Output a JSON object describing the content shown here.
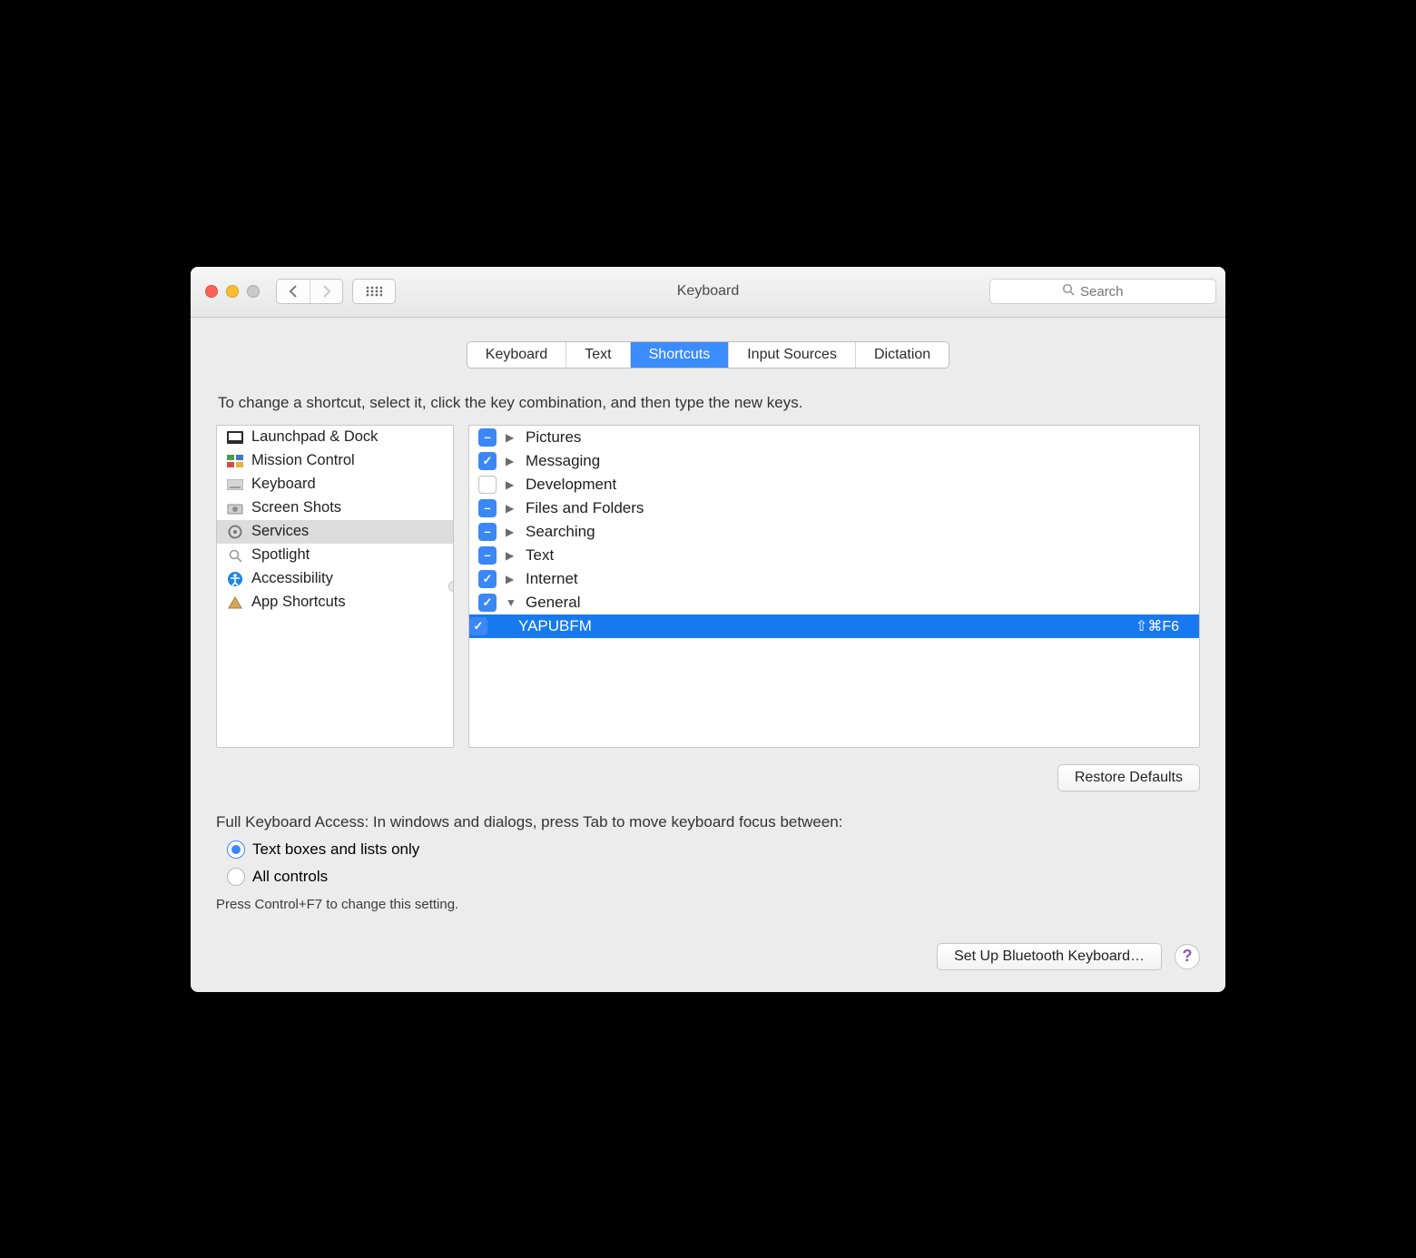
{
  "window": {
    "title": "Keyboard"
  },
  "toolbar": {
    "search_placeholder": "Search"
  },
  "tabs": {
    "keyboard": "Keyboard",
    "text": "Text",
    "shortcuts": "Shortcuts",
    "input_sources": "Input Sources",
    "dictation": "Dictation"
  },
  "help_text": "To change a shortcut, select it, click the key combination, and then type the new keys.",
  "sidebar": {
    "items": [
      {
        "label": "Launchpad & Dock"
      },
      {
        "label": "Mission Control"
      },
      {
        "label": "Keyboard"
      },
      {
        "label": "Screen Shots"
      },
      {
        "label": "Services"
      },
      {
        "label": "Spotlight"
      },
      {
        "label": "Accessibility"
      },
      {
        "label": "App Shortcuts"
      }
    ]
  },
  "services": {
    "groups": [
      {
        "label": "Pictures",
        "check": "minus",
        "expanded": false
      },
      {
        "label": "Messaging",
        "check": "on",
        "expanded": false
      },
      {
        "label": "Development",
        "check": "off",
        "expanded": false
      },
      {
        "label": "Files and Folders",
        "check": "minus",
        "expanded": false
      },
      {
        "label": "Searching",
        "check": "minus",
        "expanded": false
      },
      {
        "label": "Text",
        "check": "minus",
        "expanded": false
      },
      {
        "label": "Internet",
        "check": "on",
        "expanded": false
      },
      {
        "label": "General",
        "check": "on",
        "expanded": true
      }
    ],
    "selected_item": {
      "label": "YAPUBFM",
      "shortcut": "⇧⌘F6",
      "check": "on"
    }
  },
  "restore_defaults": "Restore Defaults",
  "fka": {
    "heading": "Full Keyboard Access: In windows and dialogs, press Tab to move keyboard focus between:",
    "opt_text": "Text boxes and lists only",
    "opt_all": "All controls",
    "hint": "Press Control+F7 to change this setting."
  },
  "footer": {
    "bluetooth": "Set Up Bluetooth Keyboard…",
    "help": "?"
  }
}
